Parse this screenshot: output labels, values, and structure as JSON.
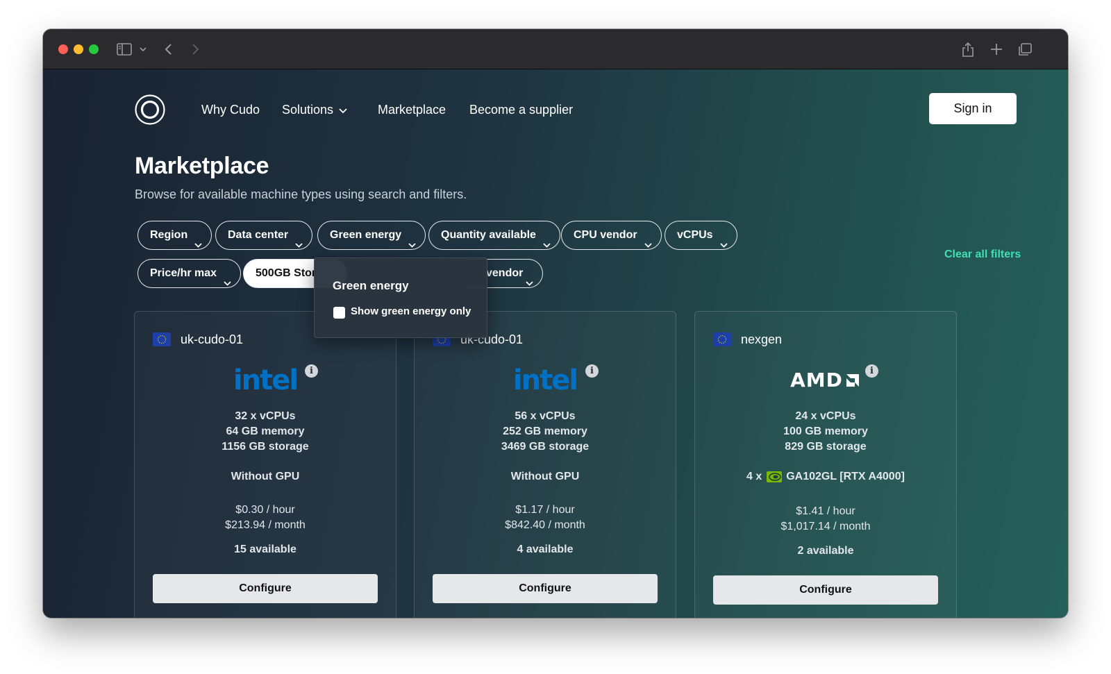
{
  "nav": {
    "links": [
      "Why Cudo",
      "Solutions",
      "Marketplace",
      "Become a supplier"
    ],
    "signin_label": "Sign in"
  },
  "page": {
    "title": "Marketplace",
    "subtitle": "Browse for available machine types using search and filters."
  },
  "filters": {
    "chips": [
      "Region",
      "Data center",
      "Green energy",
      "Quantity available",
      "CPU vendor",
      "vCPUs",
      "Price/hr max",
      "500GB Stor",
      "vendor"
    ],
    "clear_label": "Clear all filters"
  },
  "popover": {
    "title": "Green energy",
    "checkbox_label": "Show green energy only",
    "checked": false
  },
  "cards": [
    {
      "name": "uk-cudo-01",
      "vendor": "intel",
      "vcpus": "32 x vCPUs",
      "memory": "64 GB memory",
      "storage": "1156 GB storage",
      "gpu": "Without GPU",
      "price_hour": "$0.30 / hour",
      "price_month": "$213.94 / month",
      "available": "15 available",
      "action": "Configure"
    },
    {
      "name": "uk-cudo-01",
      "vendor": "intel",
      "vcpus": "56 x vCPUs",
      "memory": "252 GB memory",
      "storage": "3469 GB storage",
      "gpu": "Without GPU",
      "price_hour": "$1.17 / hour",
      "price_month": "$842.40 / month",
      "available": "4 available",
      "action": "Configure"
    },
    {
      "name": "nexgen",
      "vendor": "AMD",
      "vcpus": "24 x vCPUs",
      "memory": "100 GB memory",
      "storage": "829 GB storage",
      "gpu_prefix": "4 x",
      "gpu_model": "GA102GL [RTX A4000]",
      "price_hour": "$1.41 / hour",
      "price_month": "$1,017.14 / month",
      "available": "2 available",
      "action": "Configure"
    }
  ],
  "colors": {
    "accent": "#3fe0b4",
    "intel_blue": "#0071c5",
    "flag_blue": "#1c3fa8",
    "nvidia_green": "#76b900"
  },
  "icons": {
    "logo": "cudo-logo-icon",
    "info": "info-icon",
    "flag": "eu-flag-icon",
    "gpu": "nvidia-icon"
  }
}
